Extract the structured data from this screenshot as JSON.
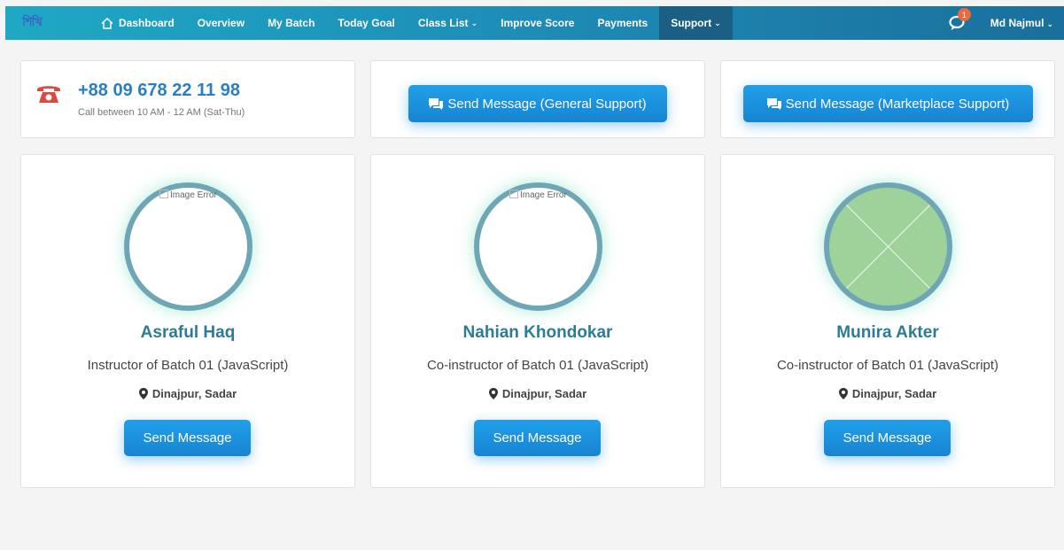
{
  "navbar": {
    "logo_text": "শিখি",
    "items": [
      {
        "label": "Dashboard",
        "icon": "home-icon"
      },
      {
        "label": "Overview"
      },
      {
        "label": "My Batch"
      },
      {
        "label": "Today Goal"
      },
      {
        "label": "Class List",
        "dropdown": true
      },
      {
        "label": "Improve Score"
      },
      {
        "label": "Payments"
      },
      {
        "label": "Support",
        "dropdown": true,
        "active": true
      }
    ],
    "chat_badge": "1",
    "user_name": "Md Najmul"
  },
  "contact": {
    "phone": "+88 09 678 22 11 98",
    "note": "Call between 10 AM - 12 AM (Sat-Thu)",
    "general_support_label": "Send Message (General Support)",
    "marketplace_support_label": "Send Message (Marketplace Support)"
  },
  "people": [
    {
      "name": "Asraful Haq",
      "role": "Instructor of Batch 01 (JavaScript)",
      "location": "Dinajpur, Sadar",
      "image_alt": "Image Error",
      "button": "Send Message"
    },
    {
      "name": "Nahian Khondokar",
      "role": "Co-instructor of Batch 01 (JavaScript)",
      "location": "Dinajpur, Sadar",
      "image_alt": "Image Error",
      "button": "Send Message"
    },
    {
      "name": "Munira Akter",
      "role": "Co-instructor of Batch 01 (JavaScript)",
      "location": "Dinajpur, Sadar",
      "button": "Send Message"
    }
  ],
  "colors": {
    "accent": "#1784d2",
    "name": "#2d7c96",
    "phone_icon": "#e0473e",
    "badge": "#e96a3a"
  }
}
